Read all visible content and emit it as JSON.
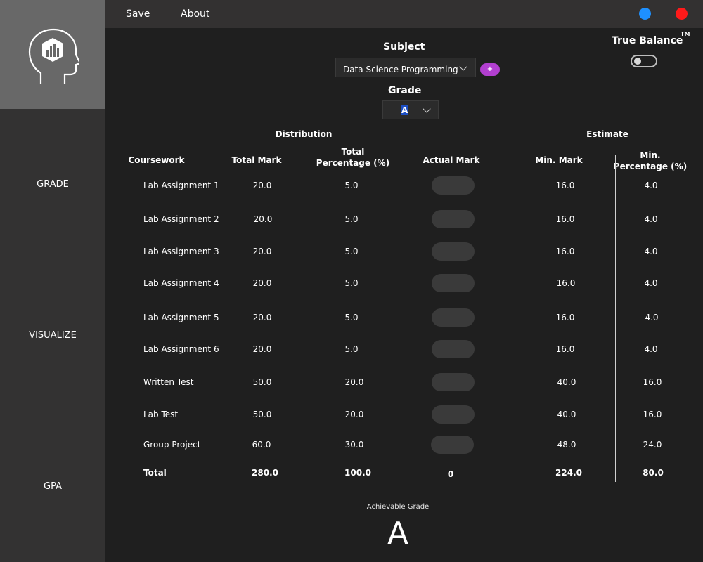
{
  "sidebar": {
    "logo_icon": "head-chart-logo-icon",
    "items": [
      {
        "label": "GRADE"
      },
      {
        "label": "VISUALIZE"
      },
      {
        "label": "GPA"
      }
    ]
  },
  "menu": {
    "save": "Save",
    "about": "About"
  },
  "window_controls": {
    "blue": "#1e90ff",
    "red": "#ff1a1a"
  },
  "subject": {
    "label": "Subject",
    "value": "Data Science Programming",
    "add_label": "+"
  },
  "grade": {
    "label": "Grade",
    "value": "A"
  },
  "true_balance": {
    "label": "True Balance",
    "tm": "TM",
    "enabled": false
  },
  "sections": {
    "distribution": "Distribution",
    "estimate": "Estimate"
  },
  "columns": {
    "coursework": "Coursework",
    "total_mark": "Total Mark",
    "total_pct_1": "Total",
    "total_pct_2": "Percentage (%)",
    "actual_mark": "Actual Mark",
    "min_mark": "Min. Mark",
    "min_pct_1": "Min.",
    "min_pct_2": "Percentage (%)"
  },
  "rows": [
    {
      "name": "Lab Assignment 1",
      "total_mark": "20.0",
      "total_pct": "5.0",
      "actual": "",
      "min_mark": "16.0",
      "min_pct": "4.0"
    },
    {
      "name": "Lab Assignment 2",
      "total_mark": "20.0",
      "total_pct": "5.0",
      "actual": "",
      "min_mark": "16.0",
      "min_pct": "4.0"
    },
    {
      "name": "Lab Assignment 3",
      "total_mark": "20.0",
      "total_pct": "5.0",
      "actual": "",
      "min_mark": "16.0",
      "min_pct": "4.0"
    },
    {
      "name": "Lab Assignment 4",
      "total_mark": "20.0",
      "total_pct": "5.0",
      "actual": "",
      "min_mark": "16.0",
      "min_pct": "4.0"
    },
    {
      "name": "Lab Assignment 5",
      "total_mark": "20.0",
      "total_pct": "5.0",
      "actual": "",
      "min_mark": "16.0",
      "min_pct": "4.0"
    },
    {
      "name": "Lab Assignment 6",
      "total_mark": "20.0",
      "total_pct": "5.0",
      "actual": "",
      "min_mark": "16.0",
      "min_pct": "4.0"
    },
    {
      "name": "Written Test",
      "total_mark": "50.0",
      "total_pct": "20.0",
      "actual": "",
      "min_mark": "40.0",
      "min_pct": "16.0"
    },
    {
      "name": "Lab Test",
      "total_mark": "50.0",
      "total_pct": "20.0",
      "actual": "",
      "min_mark": "40.0",
      "min_pct": "16.0"
    },
    {
      "name": "Group Project",
      "total_mark": "60.0",
      "total_pct": "30.0",
      "actual": "",
      "min_mark": "48.0",
      "min_pct": "24.0"
    }
  ],
  "totals": {
    "label": "Total",
    "total_mark": "280.0",
    "total_pct": "100.0",
    "actual": "0",
    "min_mark": "224.0",
    "min_pct": "80.0"
  },
  "achievable": {
    "label": "Achievable Grade",
    "value": "A"
  }
}
